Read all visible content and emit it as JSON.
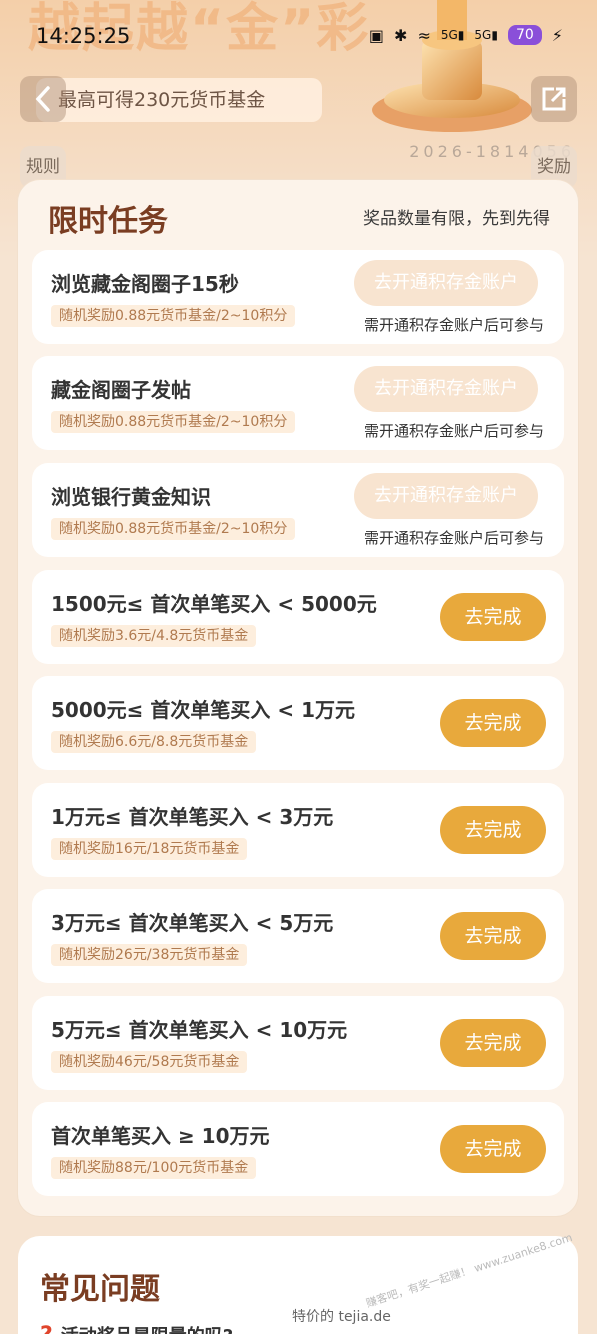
{
  "banner": {
    "title": "越起越“金”彩"
  },
  "status_bar": {
    "time": "14:25:25",
    "battery": "70",
    "net1": "5G",
    "net2": "5G"
  },
  "header": {
    "promo": "最高可得230元货币基金",
    "code": "2026-1814056",
    "rules_label": "规则",
    "rewards_label": "奖励"
  },
  "tasks": {
    "title": "限时任务",
    "note": "奖品数量有限，先到先得",
    "items": [
      {
        "name": "浏览藏金阁圈子15秒",
        "reward": "随机奖励0.88元货币基金/2~10积分",
        "button": "去开通积存金账户",
        "note": "需开通积存金账户后可参与"
      },
      {
        "name": "藏金阁圈子发帖",
        "reward": "随机奖励0.88元货币基金/2~10积分",
        "button": "去开通积存金账户",
        "note": "需开通积存金账户后可参与"
      },
      {
        "name": "浏览银行黄金知识",
        "reward": "随机奖励0.88元货币基金/2~10积分",
        "button": "去开通积存金账户",
        "note": "需开通积存金账户后可参与"
      },
      {
        "name": "1500元≤ 首次单笔买入 < 5000元",
        "reward": "随机奖励3.6元/4.8元货币基金",
        "button": "去完成"
      },
      {
        "name": "5000元≤ 首次单笔买入 < 1万元",
        "reward": "随机奖励6.6元/8.8元货币基金",
        "button": "去完成"
      },
      {
        "name": "1万元≤ 首次单笔买入 < 3万元",
        "reward": "随机奖励16元/18元货币基金",
        "button": "去完成"
      },
      {
        "name": "3万元≤ 首次单笔买入 < 5万元",
        "reward": "随机奖励26元/38元货币基金",
        "button": "去完成"
      },
      {
        "name": "5万元≤ 首次单笔买入 < 10万元",
        "reward": "随机奖励46元/58元货币基金",
        "button": "去完成"
      },
      {
        "name": "首次单笔买入 ≥ 10万元",
        "reward": "随机奖励88元/100元货币基金",
        "button": "去完成"
      }
    ]
  },
  "faq": {
    "title": "常见问题",
    "q1": "活动奖品是限量的吗?"
  },
  "watermark": {
    "text": "特价的  tejia.de",
    "text2": "赚客吧，有奖一起赚！ www.zuanke8.com"
  },
  "colors": {
    "accent": "#e8a93c",
    "title": "#7a3d22",
    "disabled": "#f8e4d0"
  }
}
